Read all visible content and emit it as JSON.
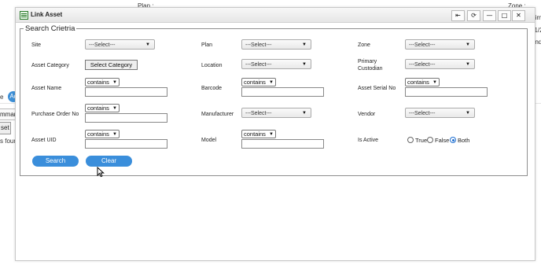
{
  "background": {
    "top_labels": [
      "Plan :",
      "Zone :"
    ],
    "left_texts": [
      "e",
      "mmar",
      "s four"
    ],
    "chip_label": "Ac",
    "left_button": "set",
    "right_texts": [
      "Dimi",
      "01/2",
      "And",
      "1"
    ]
  },
  "dialog": {
    "title": "Link Asset",
    "window_buttons": [
      "⇤",
      "⟳",
      "—",
      "□",
      "✕"
    ],
    "fieldset_legend": "Search Crietria",
    "fields": {
      "site": {
        "label": "Site",
        "value": "---Select---"
      },
      "plan": {
        "label": "Plan",
        "value": "---Select---"
      },
      "zone": {
        "label": "Zone",
        "value": "---Select---"
      },
      "asset_category": {
        "label": "Asset Category",
        "button": "Select Category"
      },
      "location": {
        "label": "Location",
        "value": "---Select---"
      },
      "primary_custodian": {
        "label_line1": "Primary",
        "label_line2": "Custodian",
        "value": "---Select---"
      },
      "asset_name": {
        "label": "Asset Name",
        "operator": "contains",
        "value": ""
      },
      "barcode": {
        "label": "Barcode",
        "operator": "contains",
        "value": ""
      },
      "asset_serial_no": {
        "label": "Asset Serial No",
        "operator": "contains",
        "value": ""
      },
      "purchase_order_no": {
        "label": "Purchase Order No",
        "operator": "contains",
        "value": ""
      },
      "manufacturer": {
        "label": "Manufacturer",
        "value": "---Select---"
      },
      "vendor": {
        "label": "Vendor",
        "value": "---Select---"
      },
      "asset_uid": {
        "label": "Asset UID",
        "operator": "contains",
        "value": ""
      },
      "model": {
        "label": "Model",
        "operator": "contains",
        "value": ""
      },
      "is_active": {
        "label": "Is Active",
        "options": [
          "True",
          "False",
          "Both"
        ],
        "selected": "Both"
      }
    },
    "buttons": {
      "search": "Search",
      "clear": "Clear"
    }
  },
  "colors": {
    "primary_button": "#3a8edb",
    "radio_selected": "#1f6fd1"
  }
}
